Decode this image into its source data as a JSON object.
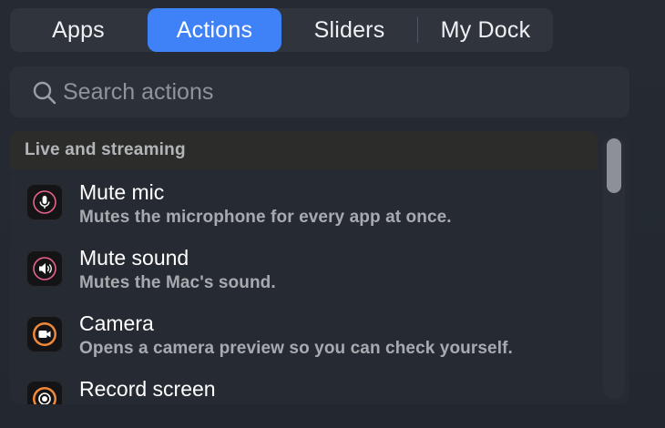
{
  "tabs": [
    {
      "label": "Apps",
      "active": false
    },
    {
      "label": "Actions",
      "active": true
    },
    {
      "label": "Sliders",
      "active": false
    },
    {
      "label": "My Dock",
      "active": false
    }
  ],
  "search": {
    "placeholder": "Search actions",
    "value": "",
    "icon": "search-icon"
  },
  "section": {
    "title": "Live and streaming"
  },
  "items": [
    {
      "title": "Mute mic",
      "description": "Mutes the microphone for every app at once.",
      "icon": "microphone-icon",
      "accent": "#e8628a"
    },
    {
      "title": "Mute sound",
      "description": "Mutes the Mac's sound.",
      "icon": "speaker-icon",
      "accent": "#e8628a"
    },
    {
      "title": "Camera",
      "description": "Opens a camera preview so you can check yourself.",
      "icon": "camera-icon",
      "accent": "#f0893a"
    },
    {
      "title": "Record screen",
      "description": "",
      "icon": "record-icon",
      "accent": "#f0893a"
    }
  ],
  "colors": {
    "active_tab": "#3f82f7",
    "pink_accent": "#e8628a",
    "orange_accent": "#f0893a"
  }
}
